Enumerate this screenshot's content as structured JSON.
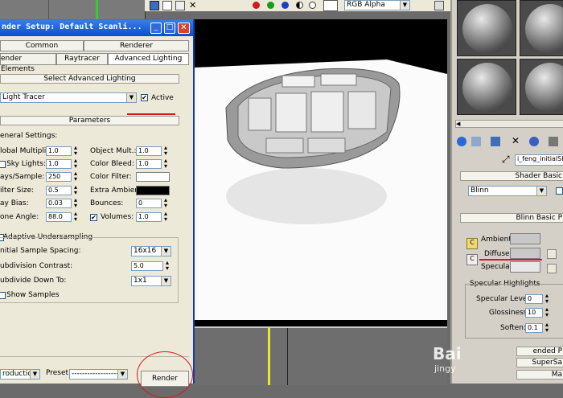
{
  "toolbar": {
    "channel_dropdown": "RGB Alpha",
    "colors": [
      "#d21a1a",
      "#1a9a1a",
      "#1a3fc4"
    ]
  },
  "window": {
    "title": "nder Setup: Default Scanli...",
    "tabs_row1": [
      "Common",
      "Renderer"
    ],
    "tabs_row2": [
      "ender Elements",
      "Raytracer",
      "Advanced Lighting"
    ]
  },
  "advanced_lighting": {
    "header": "Select Advanced Lighting",
    "selected": "Light Tracer",
    "active_label": "Active",
    "active": true
  },
  "parameters": {
    "header": "Parameters",
    "general_settings": "eneral Settings:",
    "left": [
      {
        "label": "lobal Multiplier:",
        "value": "1.0"
      },
      {
        "label": "Sky Lights:",
        "value": "1.0"
      },
      {
        "label": "ays/Sample:",
        "value": "250"
      },
      {
        "label": "ilter Size:",
        "value": "0.5"
      },
      {
        "label": "ay Bias:",
        "value": "0.03"
      },
      {
        "label": "one Angle:",
        "value": "88.0"
      }
    ],
    "right": [
      {
        "label": "Object Mult.:",
        "value": "1.0"
      },
      {
        "label": "Color Bleed:",
        "value": "1.0"
      },
      {
        "label": "Color Filter:",
        "value": ""
      },
      {
        "label": "Extra Ambient:",
        "value": ""
      },
      {
        "label": "Bounces:",
        "value": "0"
      },
      {
        "label": "Volumes:",
        "value": "1.0"
      }
    ],
    "adaptive": "Adaptive Undersampling",
    "initial_spacing_label": "nitial Sample Spacing:",
    "initial_spacing": "16x16",
    "subdivision_contrast_label": "ubdivision Contrast:",
    "subdivision_contrast": "5.0",
    "subdivide_down_label": "ubdivide Down To:",
    "subdivide_down": "1x1",
    "show_samples": "Show Samples"
  },
  "footer": {
    "mode": "roduction",
    "preset_label": "Preset:",
    "preset_value": "-------------------",
    "render": "Render"
  },
  "material_editor": {
    "name": "i_feng_initialSh",
    "shader_basic": "Shader Basic",
    "shader": "Blinn",
    "blinn_basic": "Blinn Basic P",
    "ambient": "Ambient:",
    "diffuse": "Diffuse:",
    "specular": "Specular:",
    "specular_highlights": "Specular Highlights",
    "specular_level_label": "Specular Level:",
    "specular_level": "0",
    "glossiness_label": "Glossiness:",
    "glossiness": "10",
    "soften_label": "Soften:",
    "soften": "0.1",
    "extended": "ended P",
    "supersampling": "SuperSa",
    "maps": "Ma"
  },
  "watermark": {
    "line1": "Bai",
    "line2": "jingy"
  }
}
